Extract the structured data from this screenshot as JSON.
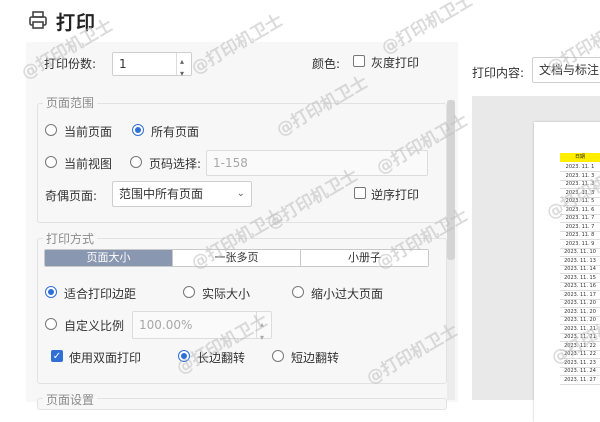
{
  "window": {
    "title": "打印",
    "icon": "printer-icon"
  },
  "copies": {
    "label": "打印份数:",
    "value": "1"
  },
  "color": {
    "label": "颜色:",
    "grayscale_label": "灰度打印",
    "grayscale_checked": false
  },
  "print_content": {
    "label": "打印内容:",
    "value": "文档与标注"
  },
  "page_range": {
    "legend": "页面范围",
    "current_page": "当前页面",
    "all_pages": "所有页面",
    "current_view": "当前视图",
    "page_select": "页码选择:",
    "page_select_placeholder": "1-158",
    "odd_even_label": "奇偶页面:",
    "odd_even_value": "范围中所有页面",
    "reverse_label": "逆序打印",
    "reverse_checked": false
  },
  "print_mode": {
    "legend": "打印方式",
    "tabs": [
      "页面大小",
      "一张多页",
      "小册子"
    ],
    "active_tab": 0,
    "fit_margins": "适合打印边距",
    "actual_size": "实际大小",
    "shrink_large": "缩小过大页面",
    "custom_scale": "自定义比例",
    "custom_scale_value": "100.00%",
    "duplex_label": "使用双面打印",
    "duplex_checked": true,
    "long_edge": "长边翻转",
    "short_edge": "短边翻转"
  },
  "page_setup": {
    "legend": "页面设置"
  },
  "preview": {
    "header": "日期",
    "rows": [
      "2023. 11. 1",
      "2023. 11. 3",
      "2023. 11. 3",
      "2023. 11. 3",
      "2023. 11. 5",
      "2023. 11. 6",
      "2023. 11. 7",
      "2023. 11. 7",
      "2023. 11. 8",
      "2023. 11. 9",
      "2023. 11. 10",
      "2023. 11. 13",
      "2023. 11. 14",
      "2023. 11. 15",
      "2023. 11. 16",
      "2023. 11. 17",
      "2023. 11. 20",
      "2023. 11. 20",
      "2023. 11. 20",
      "2023. 11. 21",
      "2023. 11. 21",
      "2023. 11. 22",
      "2023. 11. 22",
      "2023. 11. 23",
      "2023. 11. 24",
      "2023. 11. 27"
    ],
    "header_color": "#ffee00"
  },
  "watermark": {
    "text": "@打印机卫士"
  },
  "colors": {
    "accent": "#2f6fd6",
    "tab_active": "#8a97b0"
  }
}
